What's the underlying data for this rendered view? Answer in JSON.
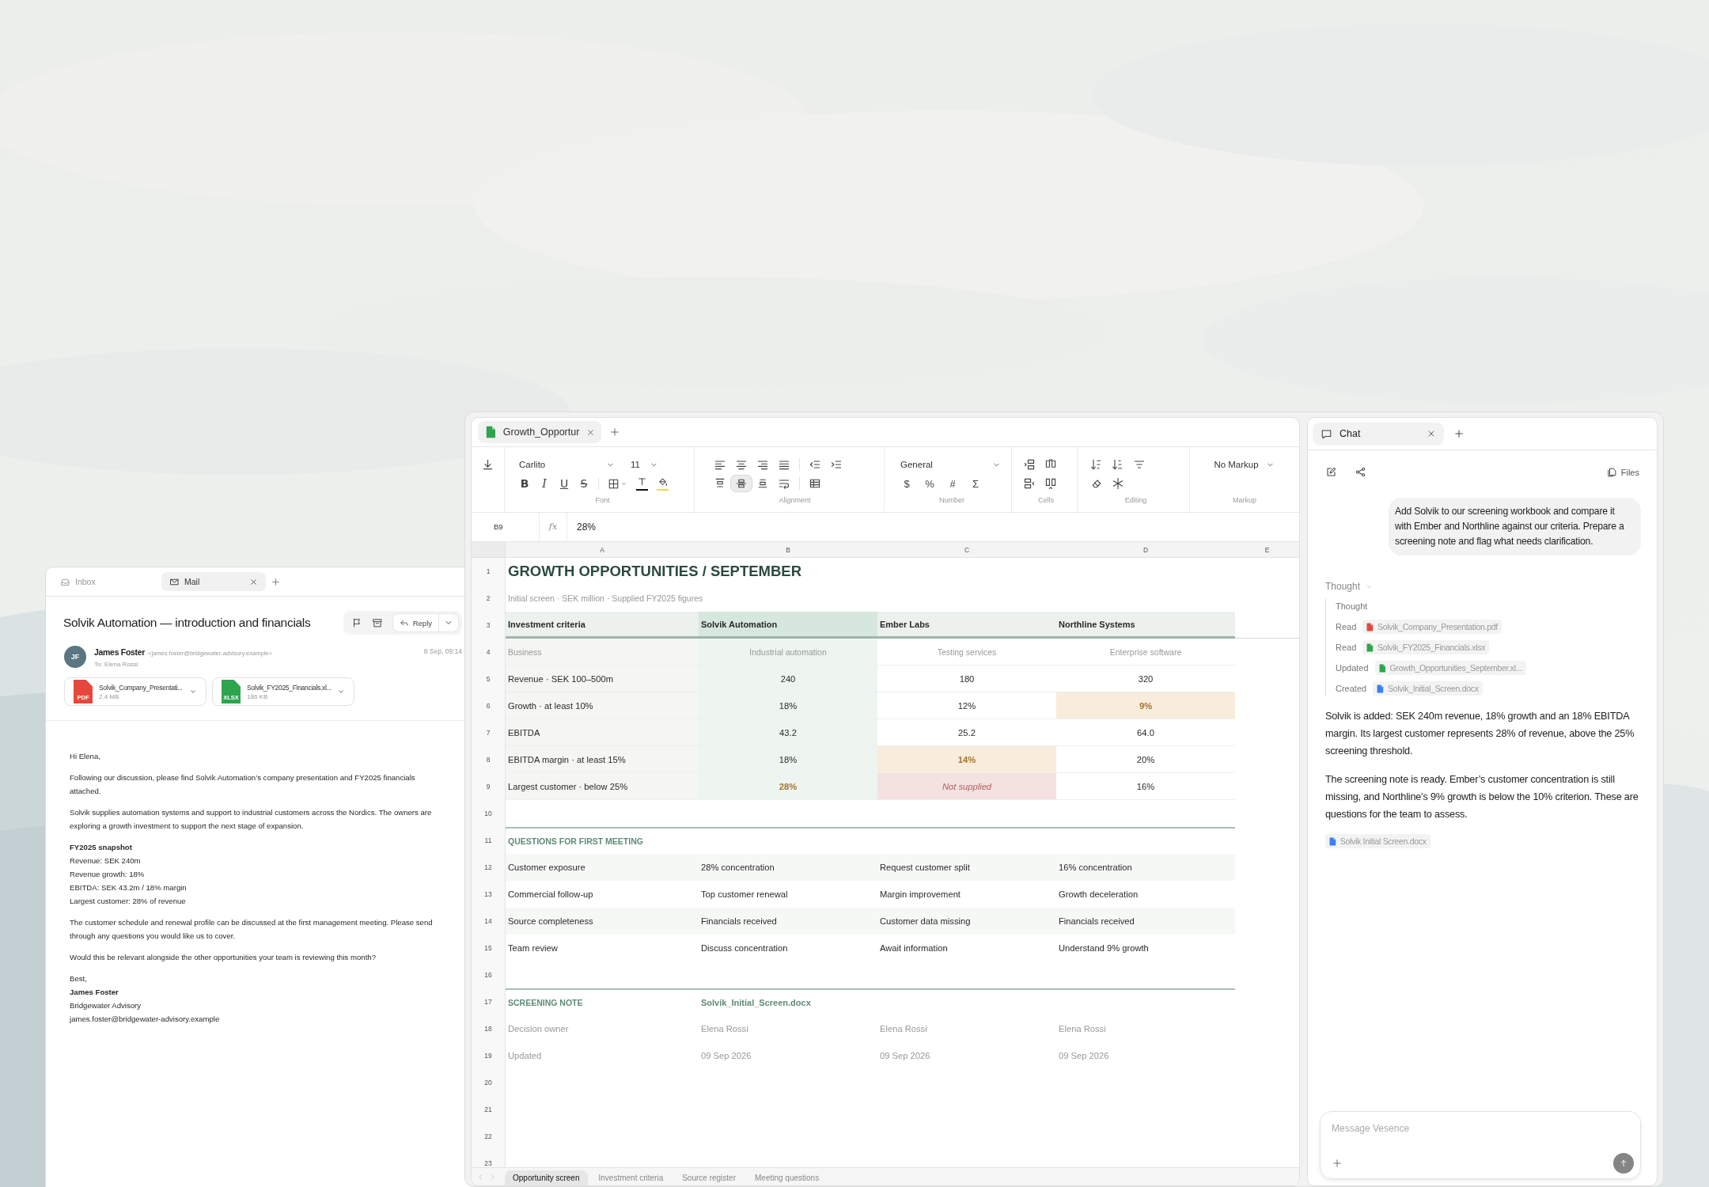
{
  "mail": {
    "tabs": [
      {
        "label": "Inbox",
        "kind": "inbox",
        "selected": false
      },
      {
        "label": "Mail",
        "kind": "mail",
        "selected": true
      }
    ],
    "subject": "Solvik Automation — introduction and financials",
    "reply": "Reply",
    "sender": {
      "initials": "JF",
      "name": "James Foster",
      "email": "<james.foster@bridgewater-advisory.example>",
      "to": "To: Elena Rossi",
      "date": "8 Sep, 09:14"
    },
    "attachments": [
      {
        "kind": "pdf",
        "badge": "PDF",
        "name": "Solvik_Company_Presentati...",
        "size": "2.4 MB"
      },
      {
        "kind": "xlsx",
        "badge": "XLSX",
        "name": "Solvik_FY2025_Financials.xl...",
        "size": "186 KB"
      }
    ],
    "body": [
      {
        "kind": "para",
        "text": "Hi Elena,"
      },
      {
        "kind": "para",
        "text": "Following our discussion, please find Solvik Automation’s company presentation and FY2025 financials attached."
      },
      {
        "kind": "para",
        "text": "Solvik supplies automation systems and support to industrial customers across the Nordics. The owners are exploring a growth investment to support the next stage of expansion."
      },
      {
        "kind": "lines",
        "lines": [
          {
            "text": "FY2025 snapshot",
            "bold": true
          },
          {
            "text": "Revenue: SEK 240m",
            "bold": false
          },
          {
            "text": "Revenue growth: 18%",
            "bold": false
          },
          {
            "text": "EBITDA: SEK 43.2m / 18% margin",
            "bold": false
          },
          {
            "text": "Largest customer: 28% of revenue",
            "bold": false
          }
        ]
      },
      {
        "kind": "para",
        "text": "The customer schedule and renewal profile can be discussed at the first management meeting. Please send through any questions you would like us to cover."
      },
      {
        "kind": "para",
        "text": "Would this be relevant alongside the other opportunities your team is reviewing this month?"
      },
      {
        "kind": "lines",
        "lines": [
          {
            "text": "Best,",
            "bold": false
          },
          {
            "text": "James Foster",
            "bold": true
          },
          {
            "text": "Bridgewater Advisory",
            "bold": false
          },
          {
            "text": "james.foster@bridgewater-advisory.example",
            "bold": false
          }
        ]
      }
    ]
  },
  "sheet": {
    "tab": "Growth_Opportur",
    "toolbar": {
      "font": "Carlito",
      "size": "11",
      "format": [
        "B",
        "I",
        "U",
        "S"
      ],
      "valign": [
        {
          "selected": false
        },
        {
          "selected": true
        },
        {
          "selected": false
        }
      ],
      "number_format": "General",
      "number_symbols": [
        "$",
        "%",
        "#",
        "Σ"
      ],
      "markup": "No Markup",
      "groups": [
        "Font",
        "Alignment",
        "Number",
        "Cells",
        "Editing",
        "Markup"
      ]
    },
    "cell_ref": "B9",
    "fx": "fx",
    "formula": "28%",
    "columns": [
      {
        "label": "A",
        "highlighted": false
      },
      {
        "label": "B",
        "highlighted": true
      },
      {
        "label": "C",
        "highlighted": false
      },
      {
        "label": "D",
        "highlighted": false
      },
      {
        "label": "E"
      }
    ],
    "rows": [
      {
        "num": "1",
        "kind": "title",
        "cells": [
          {
            "text": "GROWTH OPPORTUNITIES / SEPTEMBER"
          }
        ]
      },
      {
        "num": "2",
        "kind": "subtitle",
        "cells": [
          {
            "text": "Initial screen · SEK million · Supplied FY2025 figures"
          }
        ]
      },
      {
        "num": "3",
        "kind": "header",
        "cells": [
          {
            "text": "Investment criteria"
          },
          {
            "text": "Solvik Automation"
          },
          {
            "text": "Ember Labs"
          },
          {
            "text": "Northline Systems"
          }
        ]
      },
      {
        "num": "4",
        "kind": "muted",
        "cells": [
          {
            "text": "Business"
          },
          {
            "text": "Industrial automation"
          },
          {
            "text": "Testing services"
          },
          {
            "text": "Enterprise software"
          }
        ]
      },
      {
        "num": "5",
        "kind": "data",
        "cells": [
          {
            "text": "Revenue · SEK 100–500m"
          },
          {
            "text": "240"
          },
          {
            "text": "180"
          },
          {
            "text": "320"
          }
        ]
      },
      {
        "num": "6",
        "kind": "data",
        "cells": [
          {
            "text": "Growth · at least 10%"
          },
          {
            "text": "18%"
          },
          {
            "text": "12%"
          },
          {
            "text": "9%",
            "flagged": true
          }
        ]
      },
      {
        "num": "7",
        "kind": "data",
        "cells": [
          {
            "text": "EBITDA"
          },
          {
            "text": "43.2"
          },
          {
            "text": "25.2"
          },
          {
            "text": "64.0"
          }
        ]
      },
      {
        "num": "8",
        "kind": "data",
        "cells": [
          {
            "text": "EBITDA margin · at least 15%"
          },
          {
            "text": "18%"
          },
          {
            "text": "14%",
            "flagged": true
          },
          {
            "text": "20%"
          }
        ]
      },
      {
        "num": "9",
        "kind": "data",
        "cells": [
          {
            "text": "Largest customer · below 25%"
          },
          {
            "text": "28%",
            "flagged": true
          },
          {
            "text": "Not supplied",
            "missing": true
          },
          {
            "text": "16%"
          }
        ]
      },
      {
        "num": "10",
        "kind": "blank"
      },
      {
        "num": "11",
        "kind": "section",
        "cells": [
          {
            "text": "QUESTIONS FOR FIRST MEETING"
          }
        ]
      },
      {
        "num": "12",
        "kind": "question",
        "cells": [
          {
            "text": "Customer exposure"
          },
          {
            "text": "28% concentration"
          },
          {
            "text": "Request customer split"
          },
          {
            "text": "16% concentration"
          }
        ]
      },
      {
        "num": "13",
        "kind": "question",
        "cells": [
          {
            "text": "Commercial follow-up"
          },
          {
            "text": "Top customer renewal"
          },
          {
            "text": "Margin improvement"
          },
          {
            "text": "Growth deceleration"
          }
        ]
      },
      {
        "num": "14",
        "kind": "question",
        "cells": [
          {
            "text": "Source completeness"
          },
          {
            "text": "Financials received"
          },
          {
            "text": "Customer data missing"
          },
          {
            "text": "Financials received"
          }
        ]
      },
      {
        "num": "15",
        "kind": "question",
        "cells": [
          {
            "text": "Team review"
          },
          {
            "text": "Discuss concentration"
          },
          {
            "text": "Await information"
          },
          {
            "text": "Understand 9% growth"
          }
        ]
      },
      {
        "num": "16",
        "kind": "blank"
      },
      {
        "num": "17",
        "kind": "note",
        "cells": [
          {
            "text": "SCREENING NOTE"
          },
          {
            "text": "Solvik_Initial_Screen.docx"
          }
        ]
      },
      {
        "num": "18",
        "kind": "meta",
        "cells": [
          {
            "text": "Decision owner"
          },
          {
            "text": "Elena Rossi"
          },
          {
            "text": "Elena Rossi"
          },
          {
            "text": "Elena Rossi"
          }
        ]
      },
      {
        "num": "19",
        "kind": "meta",
        "cells": [
          {
            "text": "Updated"
          },
          {
            "text": "09 Sep 2026"
          },
          {
            "text": "09 Sep 2026"
          },
          {
            "text": "09 Sep 2026"
          }
        ]
      },
      {
        "num": "20",
        "kind": "blank"
      },
      {
        "num": "21",
        "kind": "blank"
      },
      {
        "num": "22",
        "kind": "blank"
      },
      {
        "num": "23",
        "kind": "blank"
      }
    ],
    "sheet_tabs": [
      {
        "label": "Opportunity screen",
        "selected": true
      },
      {
        "label": "Investment criteria",
        "selected": false
      },
      {
        "label": "Source register",
        "selected": false
      },
      {
        "label": "Meeting questions",
        "selected": false
      }
    ]
  },
  "chat": {
    "tab": "Chat",
    "files": "Files",
    "user_message": "Add Solvik to our screening workbook and compare it with Ember and Northline against our criteria. Prepare a screening note and flag what needs clarification.",
    "thought": {
      "label": "Thought",
      "expanded": true,
      "steps": [
        {
          "action": "Thought"
        },
        {
          "action": "Read",
          "file": {
            "name": "Solvik_Company_Presentation.pdf",
            "kind": "pdf"
          }
        },
        {
          "action": "Read",
          "file": {
            "name": "Solvik_FY2025_Financials.xlsx",
            "kind": "xlsx"
          }
        },
        {
          "action": "Updated",
          "file": {
            "name": "Growth_Opportunities_September.xl...",
            "kind": "xlsx"
          }
        },
        {
          "action": "Created",
          "file": {
            "name": "Solvik_Initial_Screen.docx",
            "kind": "docx"
          }
        }
      ]
    },
    "reply": [
      "Solvik is added: SEK 240m revenue, 18% growth and an 18% EBITDA margin. Its largest customer represents 28% of revenue, above the 25% screening threshold.",
      "The screening note is ready. Ember’s customer concentration is still missing, and Northline’s 9% growth is below the 10% criterion. These are questions for the team to assess."
    ],
    "attachment": {
      "name": "Solvik Initial Screen.docx",
      "kind": "docx"
    },
    "input": {
      "placeholder": "Message Vesence"
    }
  }
}
